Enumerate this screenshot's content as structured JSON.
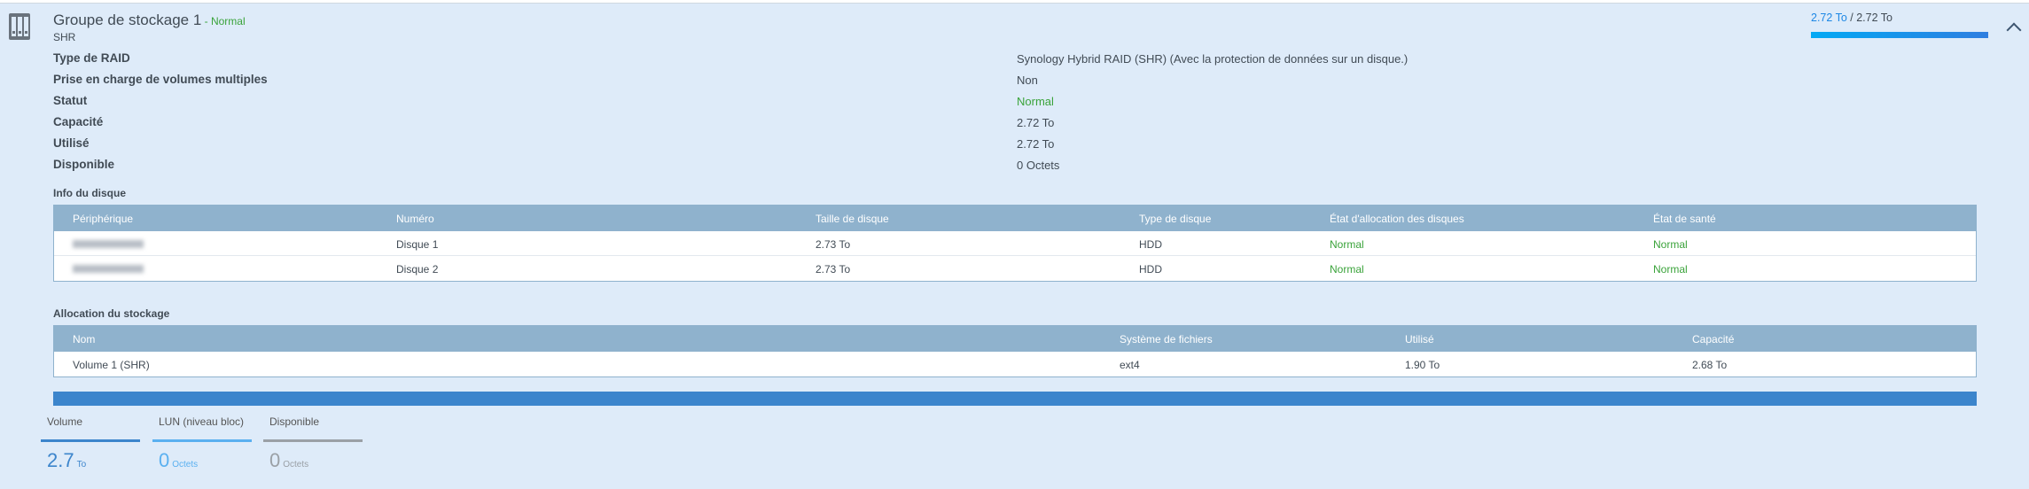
{
  "pool": {
    "title": "Groupe de stockage 1",
    "status_sep": " - ",
    "status": "Normal",
    "subtitle": "SHR",
    "usage_used": "2.72 To",
    "usage_sep": " / ",
    "usage_total": "2.72 To",
    "usage_fraction": 1.0
  },
  "details": [
    {
      "label": "Type de RAID",
      "value": "Synology Hybrid RAID (SHR) (Avec la protection de données sur un disque.)"
    },
    {
      "label": "Prise en charge de volumes multiples",
      "value": "Non"
    },
    {
      "label": "Statut",
      "value": "Normal"
    },
    {
      "label": "Capacité",
      "value": "2.72 To"
    },
    {
      "label": "Utilisé",
      "value": "2.72 To"
    },
    {
      "label": "Disponible",
      "value": "0 Octets"
    }
  ],
  "disk_info": {
    "title": "Info du disque",
    "columns": [
      "Périphérique",
      "Numéro",
      "Taille de disque",
      "Type de disque",
      "État d'allocation des disques",
      "État de santé"
    ],
    "rows": [
      [
        "",
        "Disque 1",
        "2.73 To",
        "HDD",
        "Normal",
        "Normal"
      ],
      [
        "",
        "Disque 2",
        "2.73 To",
        "HDD",
        "Normal",
        "Normal"
      ]
    ]
  },
  "allocation": {
    "title": "Allocation du stockage",
    "columns": [
      "Nom",
      "Système de fichiers",
      "Utilisé",
      "Capacité"
    ],
    "rows": [
      [
        "Volume 1 (SHR)",
        "ext4",
        "1.90 To",
        "2.68 To"
      ]
    ]
  },
  "legend": [
    {
      "label": "Volume",
      "value": "2.7",
      "unit": "To",
      "color": "#3c85cc"
    },
    {
      "label": "LUN (niveau bloc)",
      "value": "0",
      "unit": "Octets",
      "color": "#5ab0f0"
    },
    {
      "label": "Disponible",
      "value": "0",
      "unit": "Octets",
      "color": "#9aa0a6"
    }
  ]
}
